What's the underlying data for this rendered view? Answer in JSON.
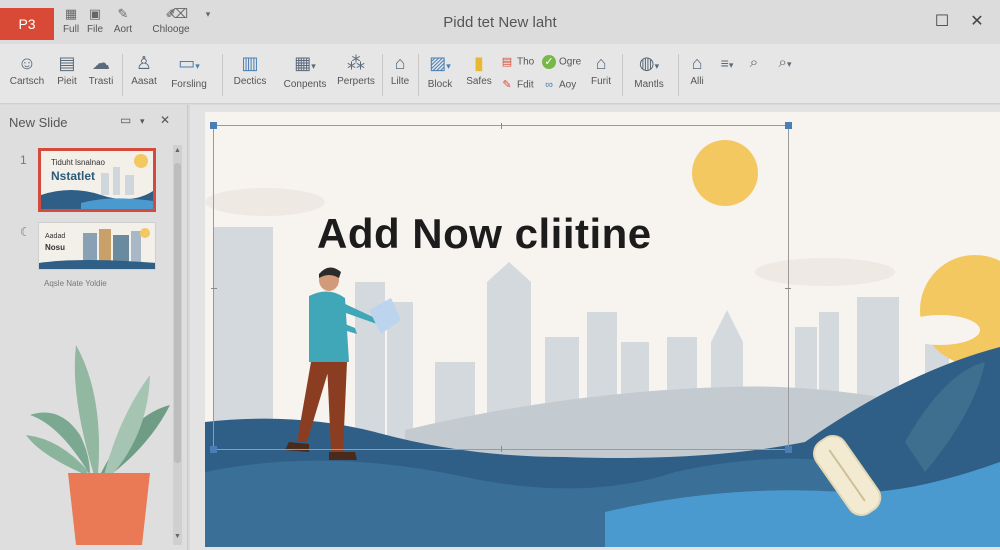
{
  "app": {
    "badge": "P3",
    "window_title": "Pidd tet New laht"
  },
  "quick_access": [
    {
      "icon": "grid-icon",
      "glyph": "▦",
      "label": "Full"
    },
    {
      "icon": "file-icon",
      "glyph": "▣",
      "label": "File"
    },
    {
      "icon": "pen-icon",
      "glyph": "✎",
      "label": "Aort"
    },
    {
      "icon": "brush-icon",
      "glyph": "✐",
      "label": "Chlooge"
    },
    {
      "icon": "eraser-icon",
      "glyph": "⌫",
      "label": ""
    }
  ],
  "ribbon": {
    "items": [
      {
        "icon": "person-icon",
        "glyph": "☺",
        "label": "Cartsch"
      },
      {
        "icon": "clipboard-icon",
        "glyph": "▤",
        "label": "Pieit"
      },
      {
        "icon": "cloud-icon",
        "glyph": "☁",
        "label": "Trasti"
      },
      {
        "icon": "user-icon",
        "glyph": "♙",
        "label": "Aasat"
      },
      {
        "icon": "display-icon",
        "glyph": "▭",
        "label": "Forsling"
      },
      {
        "icon": "document-icon",
        "glyph": "▥",
        "label": "Dectics"
      },
      {
        "icon": "table-icon",
        "glyph": "▦",
        "label": "Conpents"
      },
      {
        "icon": "shapes-icon",
        "glyph": "⁂",
        "label": "Perperts"
      },
      {
        "icon": "house-icon",
        "glyph": "⌂",
        "label": "Lilte"
      },
      {
        "icon": "picture-icon",
        "glyph": "▨",
        "label": "Block"
      },
      {
        "icon": "folder-icon",
        "glyph": "▮",
        "label": "Safes"
      },
      {
        "icon": "home-icon",
        "glyph": "⌂",
        "label": "Furit"
      },
      {
        "icon": "globe-icon",
        "glyph": "◍",
        "label": "Mantls"
      },
      {
        "icon": "building-icon",
        "glyph": "⌂",
        "label": "Alli"
      }
    ],
    "small_items": [
      {
        "icon": "document-small-icon",
        "glyph": "▤",
        "label": "Tho"
      },
      {
        "icon": "edit-icon",
        "glyph": "✎",
        "label": "Fdit"
      },
      {
        "icon": "check-icon",
        "glyph": "✓",
        "label": "Ogre"
      },
      {
        "icon": "link-icon",
        "glyph": "∞",
        "label": "Aoy"
      }
    ]
  },
  "slides_pane": {
    "title": "New Slide",
    "slides": [
      {
        "number": "1",
        "line1": "Tiduht lsnalnao",
        "line2": "Nstatlet"
      },
      {
        "number": "2",
        "line1": "Aadad",
        "line2": "Nosu"
      }
    ],
    "caption": "Aqsle Nate Yoldie"
  },
  "slide": {
    "title": "Add Now cliitine"
  },
  "colors": {
    "accent": "#d84a35",
    "selection": "#4a7fb5",
    "sun": "#f3c860",
    "hill": "#2f5f86"
  }
}
